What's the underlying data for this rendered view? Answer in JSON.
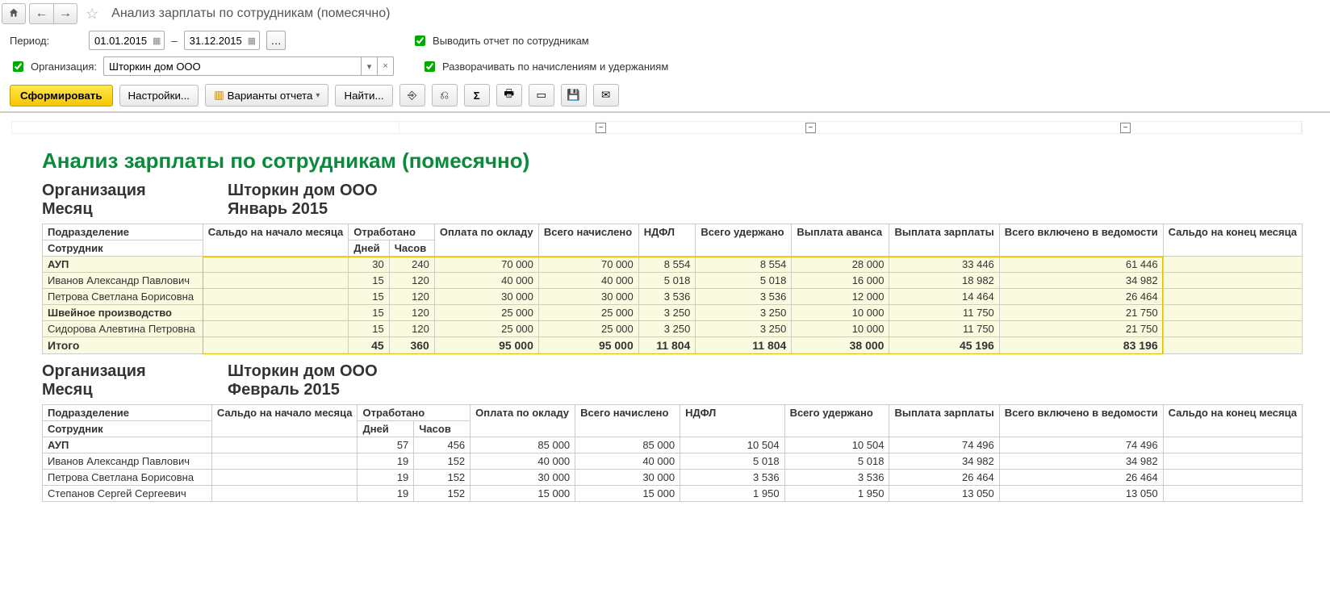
{
  "title": "Анализ зарплаты по сотрудникам (помесячно)",
  "period": {
    "label": "Период:",
    "from": "01.01.2015",
    "to": "31.12.2015",
    "dash": "–"
  },
  "check_by_emp": "Выводить отчет по сотрудникам",
  "check_expand": "Разворачивать по начислениям и удержаниям",
  "org_check": "Организация:",
  "org_value": "Шторкин дом ООО",
  "toolbar": {
    "form": "Сформировать",
    "settings": "Настройки...",
    "variants": "Варианты отчета",
    "find": "Найти..."
  },
  "report": {
    "heading": "Анализ зарплаты по сотрудникам (помесячно)",
    "org_label": "Организация",
    "month_label": "Месяц",
    "org_value": "Шторкин дом ООО",
    "month_jan": "Январь 2015",
    "month_feb": "Февраль 2015",
    "columns": {
      "dept": "Подразделение",
      "emp": "Сотрудник",
      "saldo_start": "Сальдо на начало месяца",
      "worked": "Отработано",
      "days": "Дней",
      "hours": "Часов",
      "salary_pay": "Оплата по окладу",
      "accrued_total": "Всего начислено",
      "ndfl": "НДФЛ",
      "withheld_total": "Всего удержано",
      "advance_pay": "Выплата аванса",
      "salary_payout": "Выплата зарплаты",
      "included_total": "Всего включено в ведомости",
      "saldo_end": "Сальдо на конец месяца"
    },
    "jan": {
      "rows": [
        {
          "n": "АУП",
          "d": "30",
          "h": "240",
          "sp": "70 000",
          "at": "70 000",
          "nd": "8 554",
          "wt": "8 554",
          "ap": "28 000",
          "so": "33 446",
          "it": "61 446",
          "dept": true
        },
        {
          "n": "Иванов Александр Павлович",
          "d": "15",
          "h": "120",
          "sp": "40 000",
          "at": "40 000",
          "nd": "5 018",
          "wt": "5 018",
          "ap": "16 000",
          "so": "18 982",
          "it": "34 982"
        },
        {
          "n": "Петрова Светлана Борисовна",
          "d": "15",
          "h": "120",
          "sp": "30 000",
          "at": "30 000",
          "nd": "3 536",
          "wt": "3 536",
          "ap": "12 000",
          "so": "14 464",
          "it": "26 464"
        },
        {
          "n": "Швейное производство",
          "d": "15",
          "h": "120",
          "sp": "25 000",
          "at": "25 000",
          "nd": "3 250",
          "wt": "3 250",
          "ap": "10 000",
          "so": "11 750",
          "it": "21 750",
          "dept": true
        },
        {
          "n": "Сидорова Алевтина Петровна",
          "d": "15",
          "h": "120",
          "sp": "25 000",
          "at": "25 000",
          "nd": "3 250",
          "wt": "3 250",
          "ap": "10 000",
          "so": "11 750",
          "it": "21 750"
        }
      ],
      "total": {
        "n": "Итого",
        "d": "45",
        "h": "360",
        "sp": "95 000",
        "at": "95 000",
        "nd": "11 804",
        "wt": "11 804",
        "ap": "38 000",
        "so": "45 196",
        "it": "83 196"
      }
    },
    "feb": {
      "rows": [
        {
          "n": "АУП",
          "d": "57",
          "h": "456",
          "sp": "85 000",
          "at": "85 000",
          "nd": "10 504",
          "wt": "10 504",
          "so": "74 496",
          "it": "74 496",
          "dept": true
        },
        {
          "n": "Иванов Александр Павлович",
          "d": "19",
          "h": "152",
          "sp": "40 000",
          "at": "40 000",
          "nd": "5 018",
          "wt": "5 018",
          "so": "34 982",
          "it": "34 982"
        },
        {
          "n": "Петрова Светлана Борисовна",
          "d": "19",
          "h": "152",
          "sp": "30 000",
          "at": "30 000",
          "nd": "3 536",
          "wt": "3 536",
          "so": "26 464",
          "it": "26 464"
        },
        {
          "n": "Степанов Сергей Сергеевич",
          "d": "19",
          "h": "152",
          "sp": "15 000",
          "at": "15 000",
          "nd": "1 950",
          "wt": "1 950",
          "so": "13 050",
          "it": "13 050"
        }
      ]
    }
  }
}
